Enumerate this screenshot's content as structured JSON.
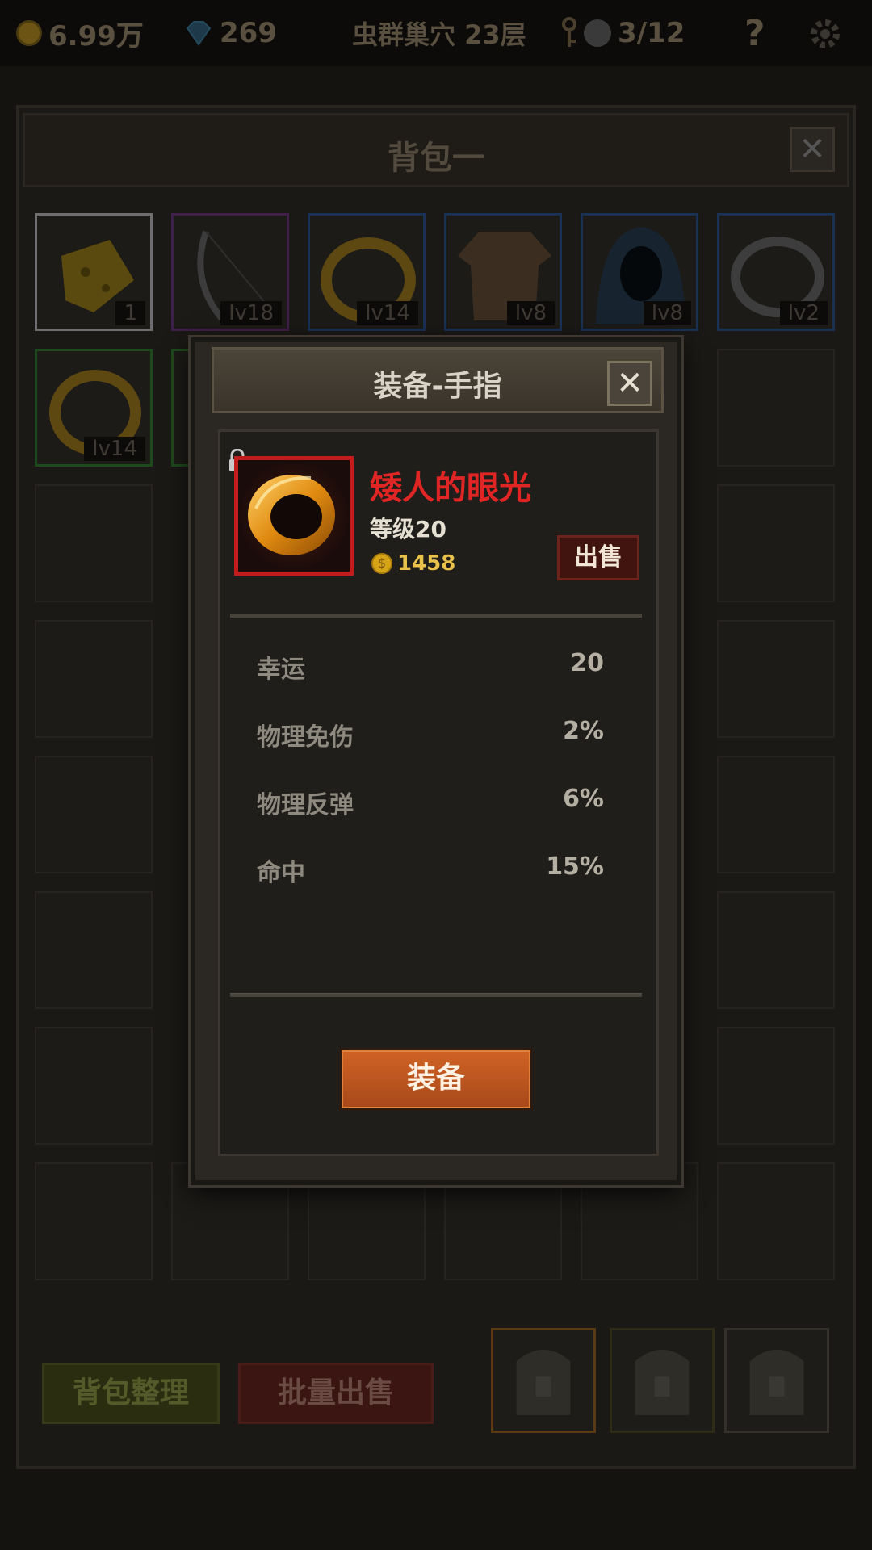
{
  "topbar": {
    "gold": "6.99万",
    "gems": "269",
    "location": "虫群巢穴 23层",
    "keys_progress": "3/12",
    "help": "?"
  },
  "bag": {
    "title": "背包一",
    "close_glyph": "✕",
    "slots_row1": [
      {
        "name": "cheese",
        "label": "1",
        "border": "#8a8a8a"
      },
      {
        "name": "bow",
        "label": "lv18",
        "border": "#7a3b8f"
      },
      {
        "name": "gold-ring",
        "label": "lv14",
        "border": "#2b5fa8"
      },
      {
        "name": "leather-shirt",
        "label": "lv8",
        "border": "#2b5fa8"
      },
      {
        "name": "hood",
        "label": "lv8",
        "border": "#2b5fa8"
      },
      {
        "name": "silver-ring",
        "label": "lv2",
        "border": "#2b5fa8"
      }
    ],
    "slots_row2": [
      {
        "name": "gold-ring",
        "label": "lv14",
        "border": "#2e8a2e"
      }
    ],
    "sort_button": "背包整理",
    "bulk_sell_button": "批量出售"
  },
  "modal": {
    "title": "装备-手指",
    "close_glyph": "✕",
    "item_name": "矮人的眼光",
    "item_level": "等级20",
    "price": "1458",
    "coin_glyph": "$",
    "sell_button": "出售",
    "stats": [
      {
        "label": "幸运",
        "value": "20"
      },
      {
        "label": "物理免伤",
        "value": "2%"
      },
      {
        "label": "物理反弹",
        "value": "6%"
      },
      {
        "label": "命中",
        "value": "15%"
      }
    ],
    "equip_button": "装备"
  },
  "icons": [
    "coin-icon",
    "gem-icon",
    "key-icon",
    "skull-icon",
    "help-icon",
    "gear-icon",
    "lock-icon",
    "ring-icon",
    "backpack-icon"
  ]
}
